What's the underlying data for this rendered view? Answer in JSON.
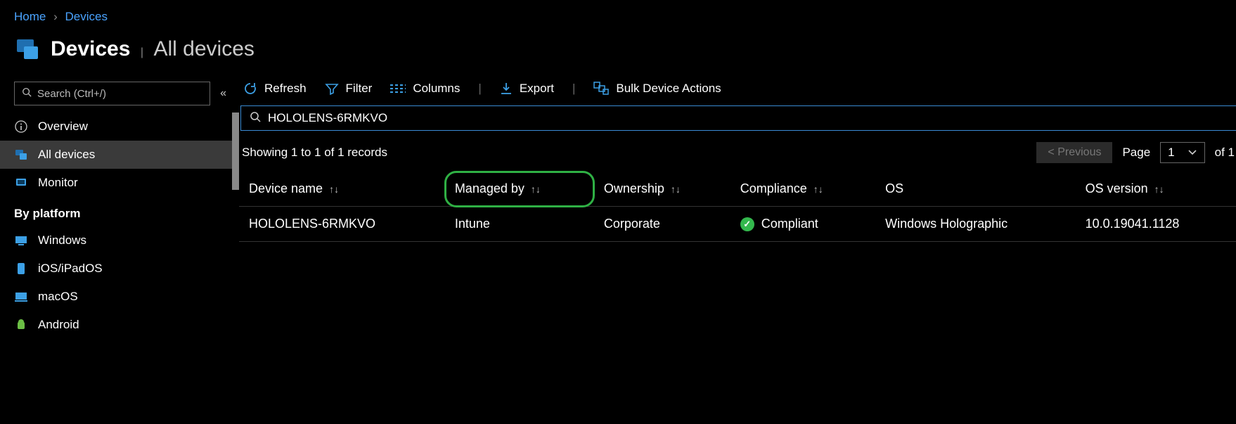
{
  "breadcrumb": {
    "home": "Home",
    "devices": "Devices"
  },
  "title": {
    "main": "Devices",
    "sub": "All devices"
  },
  "sidebar": {
    "search_placeholder": "Search (Ctrl+/)",
    "items": [
      {
        "label": "Overview"
      },
      {
        "label": "All devices"
      },
      {
        "label": "Monitor"
      }
    ],
    "platform_heading": "By platform",
    "platforms": [
      {
        "label": "Windows"
      },
      {
        "label": "iOS/iPadOS"
      },
      {
        "label": "macOS"
      },
      {
        "label": "Android"
      }
    ]
  },
  "toolbar": {
    "refresh": "Refresh",
    "filter": "Filter",
    "columns": "Columns",
    "export": "Export",
    "bulk": "Bulk Device Actions"
  },
  "filter_value": "HOLOLENS-6RMKVO",
  "records_text": "Showing 1 to 1 of 1 records",
  "pager": {
    "previous": "< Previous",
    "page_label": "Page",
    "page_value": "1",
    "of_text": "of 1"
  },
  "table": {
    "headers": {
      "device_name": "Device name",
      "managed_by": "Managed by",
      "ownership": "Ownership",
      "compliance": "Compliance",
      "os": "OS",
      "os_version": "OS version"
    },
    "row": {
      "device_name": "HOLOLENS-6RMKVO",
      "managed_by": "Intune",
      "ownership": "Corporate",
      "compliance": "Compliant",
      "os": "Windows Holographic",
      "os_version": "10.0.19041.1128"
    }
  }
}
